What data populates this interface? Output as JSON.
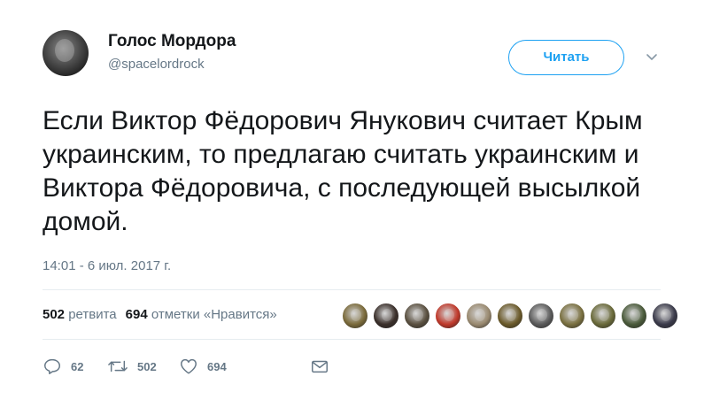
{
  "author": {
    "name": "Голос Мордора",
    "handle": "@spacelordrock"
  },
  "follow_button": "Читать",
  "tweet_text": "Если Виктор Фёдорович Янукович считает Крым украинским, то предлагаю считать украинским и Виктора Фёдоровича, с последующей высылкой домой.",
  "timestamp": "14:01 - 6 июл. 2017 г.",
  "stats": {
    "retweets_count": "502",
    "retweets_label": "ретвита",
    "likes_count": "694",
    "likes_label": "отметки «Нравится»"
  },
  "liker_avatars": [
    {
      "color": "#7a6a3a"
    },
    {
      "color": "#3a2f2a"
    },
    {
      "color": "#5a5040"
    },
    {
      "color": "#c0392b"
    },
    {
      "color": "#9a8a70"
    },
    {
      "color": "#6b5a2a"
    },
    {
      "color": "#5a5a5a"
    },
    {
      "color": "#7a7040"
    },
    {
      "color": "#6a6a3a"
    },
    {
      "color": "#4a5a3a"
    },
    {
      "color": "#3a3a4a"
    }
  ],
  "actions": {
    "reply_count": "62",
    "retweet_count": "502",
    "like_count": "694"
  },
  "icons": [
    "chevron-down-icon",
    "reply-icon",
    "retweet-icon",
    "heart-icon",
    "envelope-icon"
  ],
  "colors": {
    "accent": "#1da1f2",
    "secondary_text": "#657786",
    "primary_text": "#14171a",
    "divider": "#e6ecf0"
  }
}
